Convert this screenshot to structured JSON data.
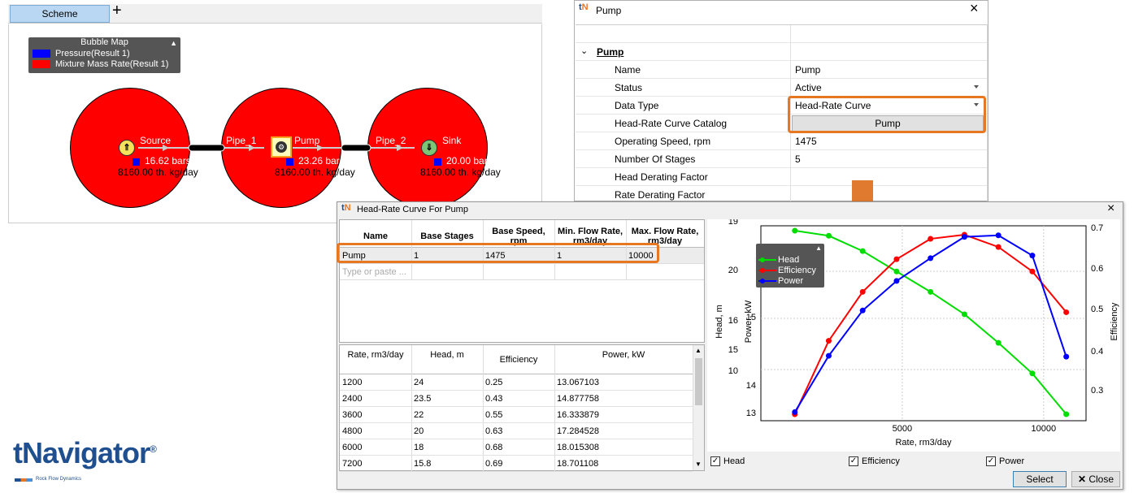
{
  "scheme": {
    "tab_label": "Scheme",
    "add_tab": "+",
    "legend": {
      "title": "Bubble Map",
      "items": [
        {
          "label": "Pressure(Result 1)",
          "color": "#0000ff"
        },
        {
          "label": "Mixture Mass Rate(Result 1)",
          "color": "#ff0000"
        }
      ]
    },
    "nodes": {
      "source": {
        "label": "Source",
        "pressure": "16.62 bars",
        "rate": "8160.00 th. kg/day"
      },
      "pipe1": {
        "label": "Pipe_1"
      },
      "pump": {
        "label": "Pump",
        "pressure": "23.26 bars",
        "rate": "8160.00 th. kg/day"
      },
      "pipe2": {
        "label": "Pipe_2"
      },
      "sink": {
        "label": "Sink",
        "pressure": "20.00 bars",
        "rate": "8160.00 th. kg/day"
      }
    }
  },
  "pump_window": {
    "title": "Pump",
    "close": "×",
    "group": "Pump",
    "properties": [
      {
        "key": "Name",
        "value": "Pump"
      },
      {
        "key": "Status",
        "value": "Active"
      },
      {
        "key": "Data Type",
        "value": "Head-Rate Curve"
      },
      {
        "key": "Head-Rate Curve Catalog",
        "value": "Pump"
      },
      {
        "key": "Operating Speed, rpm",
        "value": "1475"
      },
      {
        "key": "Number Of Stages",
        "value": "5"
      },
      {
        "key": "Head Derating Factor",
        "value": ""
      },
      {
        "key": "Rate Derating Factor",
        "value": ""
      }
    ]
  },
  "curve_window": {
    "title": "Head-Rate Curve For Pump",
    "close": "×",
    "catalog_headers": [
      "Name",
      "Base Stages",
      "Base Speed, rpm",
      "Min. Flow Rate, rm3/day",
      "Max. Flow Rate, rm3/day"
    ],
    "catalog_row": [
      "Pump",
      "1",
      "1475",
      "1",
      "10000"
    ],
    "placeholder": "Type or paste ...",
    "curve_headers": [
      "Rate, rm3/day",
      "Head, m",
      "Efficiency",
      "Power, kW"
    ],
    "curve_rows": [
      [
        "1200",
        "24",
        "0.25",
        "13.067103"
      ],
      [
        "2400",
        "23.5",
        "0.43",
        "14.877758"
      ],
      [
        "3600",
        "22",
        "0.55",
        "16.333879"
      ],
      [
        "4800",
        "20",
        "0.63",
        "17.284528"
      ],
      [
        "6000",
        "18",
        "0.68",
        "18.015308"
      ],
      [
        "7200",
        "15.8",
        "0.69",
        "18.701108"
      ]
    ],
    "checkboxes": [
      "Head",
      "Efficiency",
      "Power"
    ],
    "select_button": "Select",
    "close_button": "Close"
  },
  "chart_data": {
    "type": "line",
    "xlabel": "Rate, rm3/day",
    "ylabel_head": "Head, m",
    "ylabel_power": "Power, kW",
    "ylabel_eff": "Efficiency",
    "x_ticks": [
      "5000",
      "10000"
    ],
    "head_ticks": [
      "19",
      "20",
      "16",
      "15",
      "10"
    ],
    "power_ticks": [
      "15",
      "14",
      "13"
    ],
    "eff_ticks": [
      "0.7",
      "0.6",
      "0.5",
      "0.4",
      "0.3"
    ],
    "x": [
      1200,
      2400,
      3600,
      4800,
      6000,
      7200,
      8400,
      9600,
      10800
    ],
    "series": [
      {
        "name": "Head",
        "color": "#00dd00",
        "values": [
          24,
          23.5,
          22,
          20,
          18,
          15.8,
          13,
          10,
          6
        ]
      },
      {
        "name": "Efficiency",
        "color": "#ff0000",
        "values": [
          0.25,
          0.43,
          0.55,
          0.63,
          0.68,
          0.69,
          0.66,
          0.6,
          0.5
        ]
      },
      {
        "name": "Power",
        "color": "#0000ff",
        "values": [
          13.067103,
          14.877758,
          16.333879,
          17.284528,
          18.015308,
          18.701108,
          18.75,
          18.1,
          14.85
        ]
      }
    ]
  },
  "branding": {
    "logo": "tNavigator",
    "tagline": "Rock Flow Dynamics",
    "registered": "®"
  }
}
